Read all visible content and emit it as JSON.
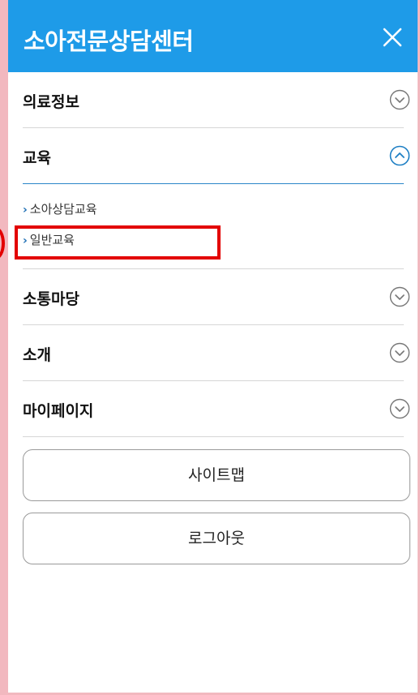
{
  "header": {
    "title": "소아전문상담센터",
    "close_icon": "close-icon"
  },
  "menu": {
    "items": [
      {
        "label": "의료정보",
        "state": "collapsed"
      },
      {
        "label": "교육",
        "state": "expanded"
      },
      {
        "label": "소통마당",
        "state": "collapsed"
      },
      {
        "label": "소개",
        "state": "collapsed"
      },
      {
        "label": "마이페이지",
        "state": "collapsed"
      }
    ],
    "education_sub": [
      {
        "label": "소아상담교육"
      },
      {
        "label": "일반교육"
      }
    ]
  },
  "buttons": {
    "sitemap_label": "사이트맵",
    "logout_label": "로그아웃"
  },
  "colors": {
    "header_bg": "#1e9be8",
    "accent": "#2a86c9",
    "highlight": "#e30000"
  }
}
